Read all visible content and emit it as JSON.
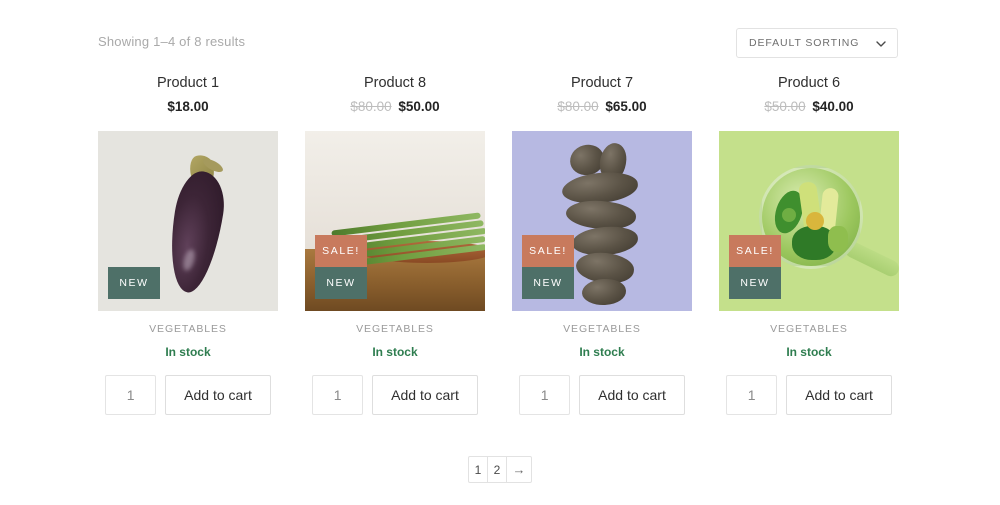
{
  "topbar": {
    "result_count": "Showing 1–4 of 8 results",
    "sorting": {
      "selected": "DEFAULT SORTING",
      "options": [
        "DEFAULT SORTING"
      ]
    }
  },
  "labels": {
    "add_to_cart": "Add to cart",
    "in_stock": "In stock",
    "category": "VEGETABLES",
    "badge_sale": "SALE!",
    "badge_new": "NEW",
    "qty_value": "1"
  },
  "colors": {
    "badge_sale": "#c87a5d",
    "badge_new": "#4e7068",
    "in_stock": "#2e7d4f",
    "price_old": "#bdbdbd",
    "price_now": "#242424",
    "muted_text": "#9a9a9a",
    "border": "#e2e2e2"
  },
  "products": [
    {
      "title": "Product 1",
      "price_old": "",
      "price_now": "$18.00",
      "category": "VEGETABLES",
      "stock": "In stock",
      "qty": "1",
      "add_to_cart": "Add to cart",
      "badges": [
        "NEW"
      ],
      "image_alt": "eggplant-on-gray-background"
    },
    {
      "title": "Product 8",
      "price_old": "$80.00",
      "price_now": "$50.00",
      "category": "VEGETABLES",
      "stock": "In stock",
      "qty": "1",
      "add_to_cart": "Add to cart",
      "badges": [
        "SALE!",
        "NEW"
      ],
      "image_alt": "asparagus-in-copper-bowl"
    },
    {
      "title": "Product 7",
      "price_old": "$80.00",
      "price_now": "$65.00",
      "category": "VEGETABLES",
      "stock": "In stock",
      "qty": "1",
      "add_to_cart": "Add to cart",
      "badges": [
        "SALE!",
        "NEW"
      ],
      "image_alt": "purple-potatoes-on-periwinkle-background"
    },
    {
      "title": "Product 6",
      "price_old": "$50.00",
      "price_now": "$40.00",
      "category": "VEGETABLES",
      "stock": "In stock",
      "qty": "1",
      "add_to_cart": "Add to cart",
      "badges": [
        "SALE!",
        "NEW"
      ],
      "image_alt": "green-salad-bowl-on-green-background"
    }
  ],
  "pagination": {
    "pages": [
      "1",
      "2"
    ],
    "next_arrow": "→",
    "current": "1"
  }
}
